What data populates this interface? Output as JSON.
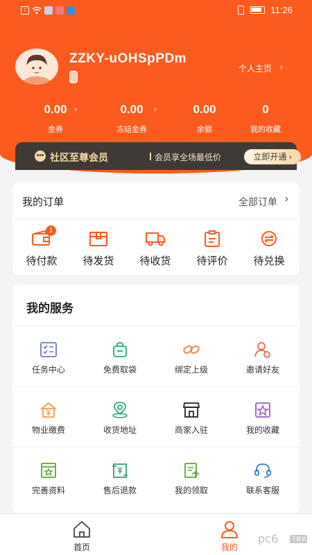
{
  "status_bar": {
    "time": "11:26"
  },
  "profile": {
    "username": "ZZKY-uOHSpPDm",
    "homepage_link": "个人主页"
  },
  "stats": [
    {
      "value": "0.00",
      "label": "金券"
    },
    {
      "value": "0.00",
      "label": "冻结金券"
    },
    {
      "value": "0.00",
      "label": "余额"
    },
    {
      "value": "0",
      "label": "我的收藏"
    }
  ],
  "vip": {
    "icon": "chat-icon",
    "title": "社区至尊会员",
    "desc": "会员享全场最低价",
    "button": "立即开通"
  },
  "orders": {
    "title": "我的订单",
    "all_link": "全部订单",
    "items": [
      {
        "label": "待付款",
        "icon": "wallet-icon",
        "badge": "1"
      },
      {
        "label": "待发货",
        "icon": "box-icon"
      },
      {
        "label": "待收货",
        "icon": "truck-icon"
      },
      {
        "label": "待评价",
        "icon": "clipboard-icon"
      },
      {
        "label": "待兑换",
        "icon": "exchange-icon"
      }
    ]
  },
  "services": {
    "title": "我的服务",
    "items": [
      {
        "label": "任务中心",
        "icon": "task-icon"
      },
      {
        "label": "免费取袋",
        "icon": "bag-icon"
      },
      {
        "label": "绑定上级",
        "icon": "link-icon"
      },
      {
        "label": "邀请好友",
        "icon": "invite-icon"
      },
      {
        "label": "物业缴费",
        "icon": "house-yen-icon"
      },
      {
        "label": "收货地址",
        "icon": "location-icon"
      },
      {
        "label": "商家入驻",
        "icon": "store-icon"
      },
      {
        "label": "我的收藏",
        "icon": "star-icon"
      },
      {
        "label": "完善资料",
        "icon": "profile-card-icon"
      },
      {
        "label": "售后退款",
        "icon": "refund-icon"
      },
      {
        "label": "我的领取",
        "icon": "receive-icon"
      },
      {
        "label": "联系客服",
        "icon": "headset-icon"
      }
    ]
  },
  "tabbar": {
    "items": [
      {
        "label": "首页",
        "icon": "home-icon"
      },
      {
        "label": "我的",
        "icon": "user-icon"
      }
    ]
  },
  "watermark": {
    "text": "pc6",
    "sub": "下载站"
  },
  "colors": {
    "brand": "#fd5a1e",
    "vip_dark": "#3f3a36",
    "vip_gold": "#f6d9a4"
  }
}
